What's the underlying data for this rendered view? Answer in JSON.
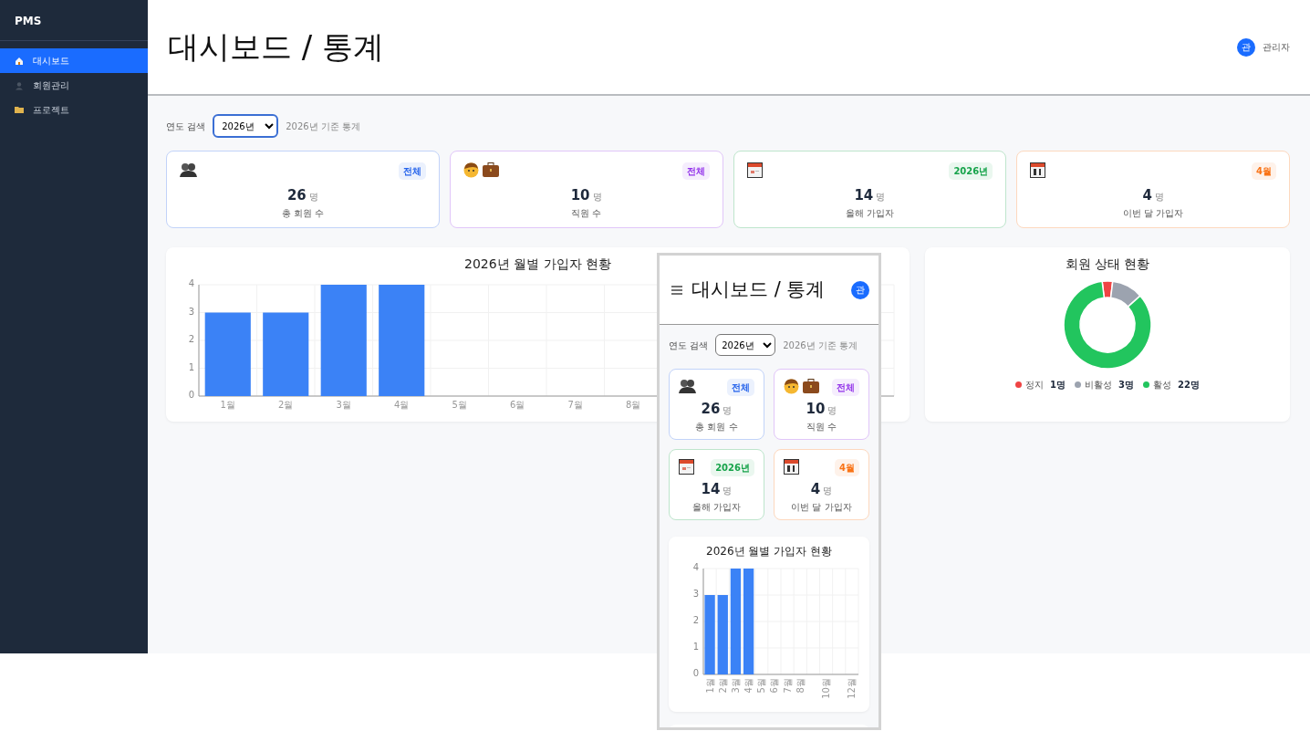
{
  "sidebar": {
    "brand": "PMS",
    "items": [
      {
        "kind": "house",
        "label": "대시보드",
        "selected": true
      },
      {
        "kind": "person",
        "label": "회원관리",
        "selected": false
      },
      {
        "kind": "folder",
        "label": "프로젝트",
        "selected": false
      }
    ]
  },
  "header": {
    "title": "대시보드 / 통계",
    "user": {
      "avatar": "관",
      "name": "관리자"
    }
  },
  "filter": {
    "label": "연도 검색",
    "value": "2026년",
    "note": "2026년 기준 통계"
  },
  "stat_cards": [
    {
      "kind": "members",
      "badge": "전체",
      "color": "#2563eb",
      "value": "26",
      "unit": "명",
      "label": "총 회원 수"
    },
    {
      "kind": "staff",
      "badge": "전체",
      "color": "#9333ea",
      "value": "10",
      "unit": "명",
      "label": "직원 수"
    },
    {
      "kind": "calendar",
      "badge": "2026년",
      "color": "#16a34a",
      "value": "14",
      "unit": "명",
      "label": "올해 가입자"
    },
    {
      "kind": "calendar31",
      "badge": "4월",
      "color": "#f97316",
      "value": "4",
      "unit": "명",
      "label": "이번 달 가입자"
    }
  ],
  "monthly_chart": {
    "chart_data": {
      "type": "bar",
      "title": "2026년 월별 가입자 현황",
      "categories": [
        "1월",
        "2월",
        "3월",
        "4월",
        "5월",
        "6월",
        "7월",
        "8월"
      ],
      "values": [
        3,
        3,
        4,
        4,
        0,
        0,
        0,
        0
      ],
      "ylim": [
        0,
        4
      ],
      "yticks": [
        0,
        1,
        2,
        3,
        4
      ],
      "grid": true
    }
  },
  "status_chart": {
    "chart_data": {
      "type": "donut",
      "title": "회원 상태 현황",
      "categories": [
        "정지",
        "비활성",
        "활성"
      ],
      "values": [
        3.85,
        11.54,
        84.61
      ]
    },
    "legend": [
      {
        "count": "1명",
        "color": "#ef4444"
      },
      {
        "count": "3명",
        "color": "#9ca3af"
      },
      {
        "count": "22명",
        "color": "#22c55e"
      }
    ]
  },
  "mobile_preview": {
    "header": {
      "title": "대시보드 / 통계",
      "avatar": "관"
    },
    "filter": {
      "label": "연도 검색",
      "value": "2026년",
      "note": "2026년 기준 통계"
    },
    "stat_cards": [
      {
        "kind": "members",
        "badge": "전체",
        "color": "#2563eb",
        "value": "26",
        "unit": "명",
        "label": "총 회원 수"
      },
      {
        "kind": "staff",
        "badge": "전체",
        "color": "#9333ea",
        "value": "10",
        "unit": "명",
        "label": "직원 수"
      },
      {
        "kind": "calendar",
        "badge": "2026년",
        "color": "#16a34a",
        "value": "14",
        "unit": "명",
        "label": "올해 가입자"
      },
      {
        "kind": "calendar31",
        "badge": "4월",
        "color": "#f97316",
        "value": "4",
        "unit": "명",
        "label": "이번 달 가입자"
      }
    ],
    "monthly_chart": {
      "chart_data": {
        "type": "bar",
        "title": "2026년 월별 가입자 현황",
        "x": [
          1,
          2,
          3,
          4,
          5,
          6,
          7,
          8,
          9,
          10,
          11,
          12
        ],
        "values": [
          3,
          3,
          4,
          4,
          0,
          0,
          0,
          0,
          0,
          0,
          0,
          0
        ],
        "xlim": [
          0.5,
          12.5
        ],
        "ylim": [
          0,
          4
        ],
        "yticks": [
          0,
          1,
          2,
          3,
          4
        ],
        "grid": true,
        "xticks": [
          {
            "value": 1,
            "label": "1월"
          },
          {
            "value": 2,
            "label": "2월"
          },
          {
            "value": 3,
            "label": "3월"
          },
          {
            "value": 4,
            "label": "4월"
          },
          {
            "value": 5,
            "label": "5월"
          },
          {
            "value": 6,
            "label": "6월"
          },
          {
            "value": 7,
            "label": "7월"
          },
          {
            "value": 8,
            "label": "8월"
          },
          {
            "value": 10,
            "label": "10월"
          },
          {
            "value": 12,
            "label": "12월"
          }
        ]
      }
    }
  }
}
